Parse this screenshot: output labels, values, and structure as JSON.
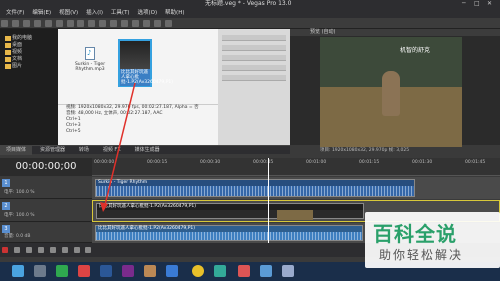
{
  "window": {
    "title": "无标题.veg * - Vegas Pro 13.0",
    "min": "─",
    "max": "□",
    "close": "✕"
  },
  "menu": {
    "items": [
      "文件(F)",
      "编辑(E)",
      "视图(V)",
      "插入(I)",
      "工具(T)",
      "选项(O)",
      "帮助(H)"
    ]
  },
  "explorer": {
    "tree": [
      "我的电脑",
      "桌面",
      "视频",
      "文档",
      "图片"
    ],
    "files": {
      "audio": {
        "name": "Surkin - Tiger Rhythm.mp3"
      },
      "video": {
        "name": "比比其好玩遥人拿心批批-1.P2(Av3260479,P1)"
      }
    },
    "info": [
      "视频: 1920x1080x32, 29.970 fps, 00:02:27.187, Alpha = 否",
      "音频: 48,000 Hz, 立体声, 00:02:27.187, AAC",
      "Ctrl+1",
      "Ctrl+3",
      "Ctrl+5"
    ]
  },
  "preview": {
    "header": "预览 (自动)",
    "caption": "机智的舒克",
    "info": "项目: 1920x1080x32, 29.970p  帧: 3,025"
  },
  "tabs": {
    "items": [
      "项目媒体",
      "资源管理器",
      "转场",
      "视频 FX",
      "媒体生成器"
    ]
  },
  "timeline": {
    "timecode": "00:00:00;00",
    "ticks": [
      "00:00:00",
      "00:00:15",
      "00:00:30",
      "00:00:45",
      "00:01:00",
      "00:01:15",
      "00:01:30",
      "00:01:45"
    ],
    "tracks": [
      {
        "num": "1",
        "level": "电平: 100.0 %",
        "clip": "Surkin - Tiger Rhythm"
      },
      {
        "num": "2",
        "level": "电平: 100.0 %",
        "clip": "比比其好玩遥人拿心批批-1.P2(Av3260479,P1)"
      },
      {
        "num": "3",
        "level": "音量: 0.0 dB",
        "clip": "比比其好玩遥人拿心批批-1.P2(Av3260479,P1)"
      }
    ]
  },
  "watermark": {
    "big": "百科全说",
    "small": "助你轻松解决"
  },
  "colors": {
    "accent": "#35a1e0",
    "watermark_green": "#2aa06a",
    "arrow": "#e0302a"
  }
}
